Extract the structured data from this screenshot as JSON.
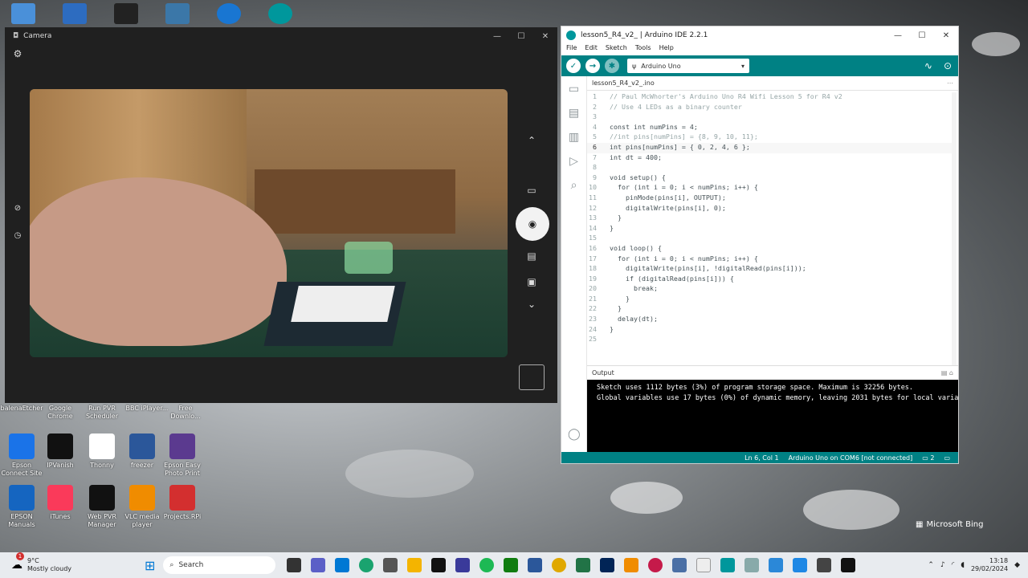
{
  "desktop": {
    "icons": [
      {
        "label": "balenaEtcher",
        "color": "#2b5b84"
      },
      {
        "label": "Google Chrome",
        "color": "#4a4a4a"
      },
      {
        "label": "Run PVR Scheduler",
        "color": "#4a4a4a"
      },
      {
        "label": "BBC iPlayer...",
        "color": "#4a4a4a"
      },
      {
        "label": "Free Downlo...",
        "color": "#4a4a4a"
      },
      {
        "label": "Epson Connect Site",
        "color": "#1a73e8"
      },
      {
        "label": "IPVanish",
        "color": "#111111"
      },
      {
        "label": "Thonny",
        "color": "#ffffff"
      },
      {
        "label": "freezer",
        "color": "#2b579a"
      },
      {
        "label": "Epson Easy Photo Print",
        "color": "#5b3a8f"
      },
      {
        "label": "EPSON Manuals",
        "color": "#1565c0"
      },
      {
        "label": "iTunes",
        "color": "#fa3a5a"
      },
      {
        "label": "Web PVR Manager",
        "color": "#111111"
      },
      {
        "label": "VLC media player",
        "color": "#f08c00"
      },
      {
        "label": "Projects.RPi",
        "color": "#d32f2f"
      }
    ],
    "bing": "Microsoft Bing"
  },
  "camera": {
    "title": "Camera",
    "minimize": "—",
    "maximize": "☐",
    "close": "✕"
  },
  "ide": {
    "title": "lesson5_R4_v2_ | Arduino IDE 2.2.1",
    "menu": [
      "File",
      "Edit",
      "Sketch",
      "Tools",
      "Help"
    ],
    "board": "Arduino Uno",
    "tab": "lesson5_R4_v2_.ino",
    "code": [
      {
        "n": "1",
        "t": "// Paul McWhorter's Arduino Uno R4 Wifi Lesson 5 for R4 v2",
        "c": "cm"
      },
      {
        "n": "2",
        "t": "// Use 4 LEDs as a binary counter",
        "c": "cm"
      },
      {
        "n": "3",
        "t": "",
        "c": "tx"
      },
      {
        "n": "4",
        "t": "const int numPins = 4;",
        "c": "tx"
      },
      {
        "n": "5",
        "t": "//int pins[numPins] = {8, 9, 10, 11};",
        "c": "cm"
      },
      {
        "n": "6",
        "t": "int pins[numPins] = { 0, 2, 4, 6 };",
        "c": "tx"
      },
      {
        "n": "7",
        "t": "int dt = 400;",
        "c": "tx"
      },
      {
        "n": "8",
        "t": "",
        "c": "tx"
      },
      {
        "n": "9",
        "t": "void setup() {",
        "c": "tx"
      },
      {
        "n": "10",
        "t": "  for (int i = 0; i < numPins; i++) {",
        "c": "tx"
      },
      {
        "n": "11",
        "t": "    pinMode(pins[i], OUTPUT);",
        "c": "tx"
      },
      {
        "n": "12",
        "t": "    digitalWrite(pins[i], 0);",
        "c": "tx"
      },
      {
        "n": "13",
        "t": "  }",
        "c": "tx"
      },
      {
        "n": "14",
        "t": "}",
        "c": "tx"
      },
      {
        "n": "15",
        "t": "",
        "c": "tx"
      },
      {
        "n": "16",
        "t": "void loop() {",
        "c": "tx"
      },
      {
        "n": "17",
        "t": "  for (int i = 0; i < numPins; i++) {",
        "c": "tx"
      },
      {
        "n": "18",
        "t": "    digitalWrite(pins[i], !digitalRead(pins[i]));",
        "c": "tx"
      },
      {
        "n": "19",
        "t": "    if (digitalRead(pins[i])) {",
        "c": "tx"
      },
      {
        "n": "20",
        "t": "      break;",
        "c": "tx"
      },
      {
        "n": "21",
        "t": "    }",
        "c": "tx"
      },
      {
        "n": "22",
        "t": "  }",
        "c": "tx"
      },
      {
        "n": "23",
        "t": "  delay(dt);",
        "c": "tx"
      },
      {
        "n": "24",
        "t": "}",
        "c": "tx"
      },
      {
        "n": "25",
        "t": "",
        "c": "tx"
      }
    ],
    "output_label": "Output",
    "output_lines": [
      "Sketch uses 1112 bytes (3%) of program storage space. Maximum is 32256 bytes.",
      "Global variables use 17 bytes (0%) of dynamic memory, leaving 2031 bytes for local varia"
    ],
    "status": {
      "pos": "Ln 6, Col 1",
      "board": "Arduino Uno on COM6 [not connected]",
      "notif": "2"
    }
  },
  "taskbar": {
    "weather_temp": "9°C",
    "weather_desc": "Mostly cloudy",
    "search": "Search",
    "time": "13:18",
    "date": "29/02/2024",
    "badge": "1"
  }
}
